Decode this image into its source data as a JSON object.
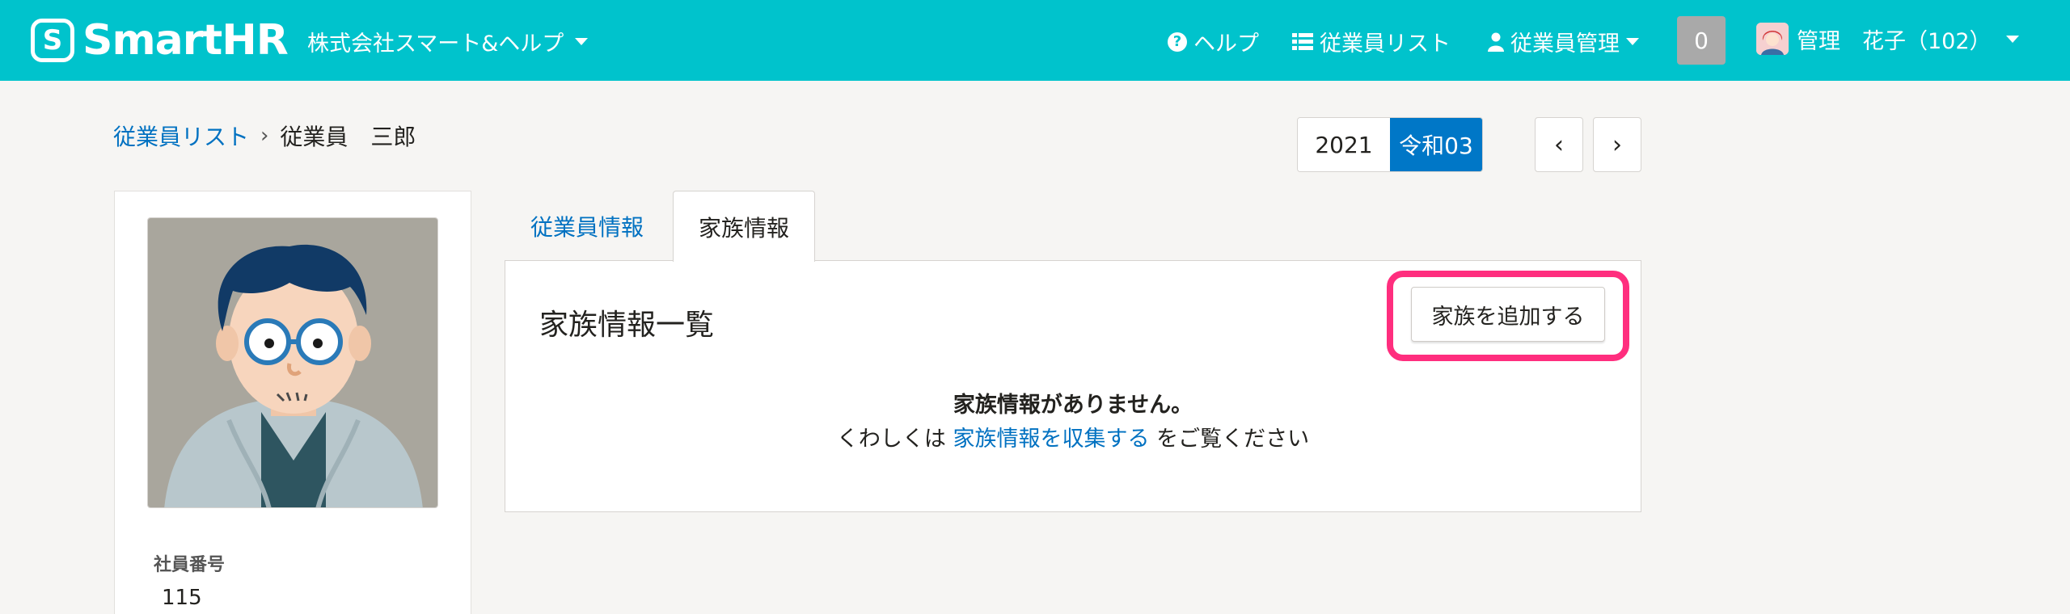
{
  "header": {
    "logo_mark": "S",
    "logo_text": "SmartHR",
    "company": "株式会社スマート&ヘルプ",
    "help": "ヘルプ",
    "employee_list": "従業員リスト",
    "employee_manage": "従業員管理",
    "notification_count": "0",
    "user_name": "管理　花子（102）",
    "brand_color": "#00c3cc"
  },
  "breadcrumb": {
    "parent": "従業員リスト",
    "separator": "›",
    "current": "従業員　三郎"
  },
  "year_selector": {
    "year": "2021",
    "era": "令和03",
    "prev_label": "‹",
    "next_label": "›"
  },
  "profile": {
    "employee_number_label": "社員番号",
    "employee_number": "115"
  },
  "tabs": [
    {
      "label": "従業員情報",
      "active": false
    },
    {
      "label": "家族情報",
      "active": true
    }
  ],
  "panel": {
    "title": "家族情報一覧",
    "add_button": "家族を追加する",
    "empty_title": "家族情報がありません。",
    "empty_prefix": "くわしくは",
    "empty_link": "家族情報を収集する",
    "empty_suffix": "をご覧ください",
    "highlight_color": "#ff2e7e"
  }
}
